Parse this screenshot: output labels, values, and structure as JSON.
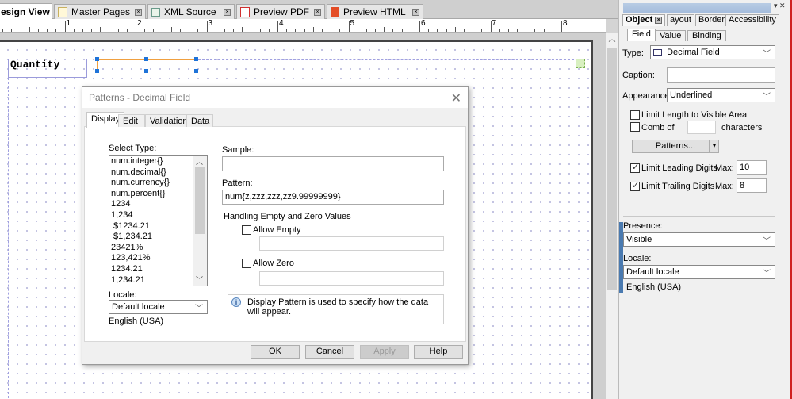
{
  "tabs": [
    {
      "label": "esign View",
      "icon": "design-view-icon",
      "active": true
    },
    {
      "label": "Master Pages",
      "icon": "page-icon"
    },
    {
      "label": "XML Source",
      "icon": "xml-icon"
    },
    {
      "label": "Preview PDF",
      "icon": "pdf-icon"
    },
    {
      "label": "Preview HTML",
      "icon": "html5-icon"
    }
  ],
  "ruler": {
    "labels": [
      "1",
      "2",
      "3",
      "4",
      "5",
      "6",
      "7",
      "8"
    ]
  },
  "canvas": {
    "caption_text": "Quantity"
  },
  "dialog": {
    "title": "Patterns - Decimal Field",
    "close_icon": "close-icon",
    "tabs": [
      "Display",
      "Edit",
      "Validation",
      "Data"
    ],
    "active_tab": "Display",
    "select_type_label": "Select Type:",
    "types": [
      "num.integer{}",
      "num.decimal{}",
      "num.currency{}",
      "num.percent{}",
      "1234",
      "1,234",
      " $1234.21",
      " $1,234.21",
      "23421%",
      "123,421%",
      "1234.21",
      "1,234.21"
    ],
    "locale_label": "Locale:",
    "locale_value": "Default locale",
    "locale_desc": "English (USA)",
    "sample_label": "Sample:",
    "sample_value": "",
    "pattern_label": "Pattern:",
    "pattern_value": "num{z,zzz,zzz,zz9.99999999}",
    "handling_label": "Handling Empty and Zero Values",
    "allow_empty_label": "Allow Empty",
    "allow_empty_checked": false,
    "allow_empty_value": "",
    "allow_zero_label": "Allow Zero",
    "allow_zero_checked": false,
    "allow_zero_value": "",
    "info_text": "Display Pattern is used to specify how the data will appear.",
    "buttons": {
      "ok": "OK",
      "cancel": "Cancel",
      "apply": "Apply",
      "help": "Help"
    }
  },
  "panel": {
    "tabs": [
      "Object",
      "ayout",
      "Border",
      "Accessibility"
    ],
    "active_tab": "Object",
    "subtabs": [
      "Field",
      "Value",
      "Binding"
    ],
    "active_subtab": "Field",
    "type_label": "Type:",
    "type_value": "Decimal Field",
    "caption_label": "Caption:",
    "caption_value": "",
    "appearance_label": "Appearance:",
    "appearance_value": "Underlined",
    "limit_length_label": "Limit Length to Visible Area",
    "limit_length_checked": false,
    "comb_label": "Comb of",
    "comb_checked": false,
    "comb_value": "",
    "characters_label": "characters",
    "patterns_button": "Patterns...",
    "limit_leading_label": "Limit Leading Digits",
    "limit_leading_checked": true,
    "limit_leading_max_label": "Max:",
    "limit_leading_max": "10",
    "limit_trailing_label": "Limit Trailing Digits",
    "limit_trailing_checked": true,
    "limit_trailing_max_label": "Max:",
    "limit_trailing_max": "8",
    "presence_label": "Presence:",
    "presence_value": "Visible",
    "locale_label": "Locale:",
    "locale_value": "Default locale",
    "locale_desc": "English (USA)"
  }
}
